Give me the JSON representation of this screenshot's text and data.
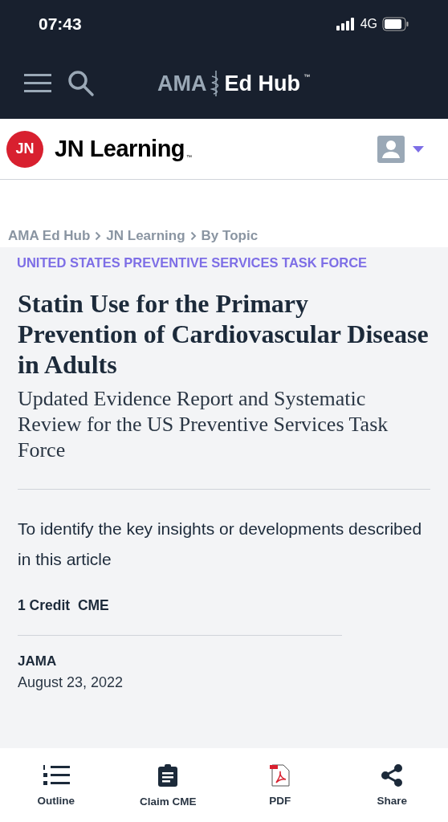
{
  "status_bar": {
    "time": "07:43",
    "network": "4G"
  },
  "nav": {
    "logo_left": "AMA",
    "logo_right": "Ed Hub",
    "logo_mark": "™"
  },
  "site_header": {
    "badge": "JN",
    "title": "JN Learning",
    "mark": "™"
  },
  "breadcrumbs": [
    "AMA Ed Hub",
    "JN Learning",
    "By Topic"
  ],
  "article": {
    "category": "UNITED STATES PREVENTIVE SERVICES TASK FORCE",
    "title": "Statin Use for the Primary Prevention of Cardiovascular Disease in Adults",
    "subtitle": "Updated Evidence Report and Systematic Review for the US Preventive Services Task Force",
    "objective": "To identify the key insights or developments described in this article",
    "credit": "1 Credit  CME",
    "journal": "JAMA",
    "date": "August 23, 2022"
  },
  "toolbar": [
    {
      "kind": "outline",
      "label": "Outline"
    },
    {
      "kind": "clipboard",
      "label": "Claim CME"
    },
    {
      "kind": "pdf",
      "label": "PDF"
    },
    {
      "kind": "share",
      "label": "Share"
    }
  ]
}
